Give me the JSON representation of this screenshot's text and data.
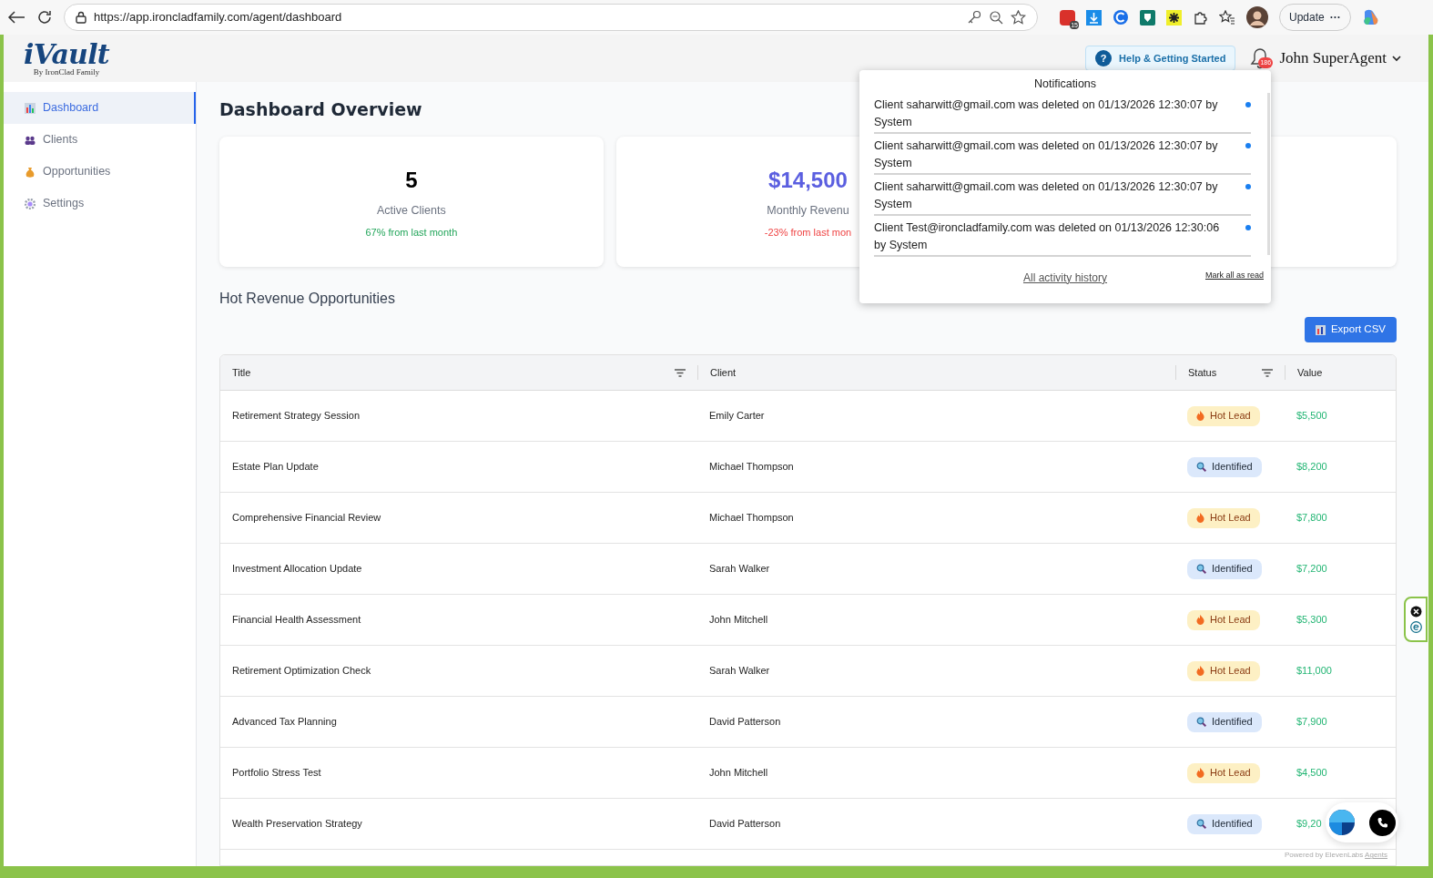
{
  "browser": {
    "url": "https://app.ironcladfamily.com/agent/dashboard",
    "calendar_badge": "15",
    "update_button": "Update",
    "update_more": "···"
  },
  "header": {
    "logo": "iVault",
    "logo_sub": "By IronClad Family",
    "help_button": "Help & Getting Started",
    "help_mark": "?",
    "bell_badge": "186",
    "user": "John SuperAgent"
  },
  "sidebar": {
    "items": [
      {
        "label": "Dashboard",
        "selected": true
      },
      {
        "label": "Clients",
        "selected": false
      },
      {
        "label": "Opportunities",
        "selected": false
      },
      {
        "label": "Settings",
        "selected": false
      }
    ]
  },
  "page_title": "Dashboard Overview",
  "stats": [
    {
      "value": "5",
      "label": "Active Clients",
      "change": "67% from last month"
    },
    {
      "value": "$14,500",
      "label": "Monthly Revenu",
      "change": "-23% from last mon"
    }
  ],
  "section_title": "Hot Revenue Opportunities",
  "export_button": "Export CSV",
  "table": {
    "columns": [
      {
        "label": "Title",
        "filter": true
      },
      {
        "label": "Client",
        "filter": false
      },
      {
        "label": "Status",
        "filter": true
      },
      {
        "label": "Value",
        "filter": false
      }
    ],
    "rows": [
      {
        "title": "Retirement Strategy Session",
        "client": "Emily Carter",
        "status": {
          "label": "Hot Lead",
          "kind": "hot"
        },
        "value": "$5,500"
      },
      {
        "title": "Estate Plan Update",
        "client": "Michael Thompson",
        "status": {
          "label": "Identified",
          "kind": "identified"
        },
        "value": "$8,200"
      },
      {
        "title": "Comprehensive Financial Review",
        "client": "Michael Thompson",
        "status": {
          "label": "Hot Lead",
          "kind": "hot"
        },
        "value": "$7,800"
      },
      {
        "title": "Investment Allocation Update",
        "client": "Sarah Walker",
        "status": {
          "label": "Identified",
          "kind": "identified"
        },
        "value": "$7,200"
      },
      {
        "title": "Financial Health Assessment",
        "client": "John Mitchell",
        "status": {
          "label": "Hot Lead",
          "kind": "hot"
        },
        "value": "$5,300"
      },
      {
        "title": "Retirement Optimization Check",
        "client": "Sarah Walker",
        "status": {
          "label": "Hot Lead",
          "kind": "hot"
        },
        "value": "$11,000"
      },
      {
        "title": "Advanced Tax Planning",
        "client": "David Patterson",
        "status": {
          "label": "Identified",
          "kind": "identified"
        },
        "value": "$7,900"
      },
      {
        "title": "Portfolio Stress Test",
        "client": "John Mitchell",
        "status": {
          "label": "Hot Lead",
          "kind": "hot"
        },
        "value": "$4,500"
      },
      {
        "title": "Wealth Preservation Strategy",
        "client": "David Patterson",
        "status": {
          "label": "Identified",
          "kind": "identified"
        },
        "value": "$9,20"
      }
    ]
  },
  "notifications": {
    "title": "Notifications",
    "items": [
      {
        "text": "Client saharwitt@gmail.com was deleted on 01/13/2026 12:30:07 by System",
        "unread": true
      },
      {
        "text": "Client saharwitt@gmail.com was deleted on 01/13/2026 12:30:07 by System",
        "unread": true
      },
      {
        "text": "Client saharwitt@gmail.com was deleted on 01/13/2026 12:30:07 by System",
        "unread": true
      },
      {
        "text": "Client Test@ironcladfamily.com was deleted on 01/13/2026 12:30:06 by System",
        "unread": true
      }
    ],
    "history_link": "All activity history",
    "mark_read_link": "Mark all as read"
  },
  "voice_widget": {
    "powered_by": "Powered by ElevenLabs",
    "agents_link": "Agents"
  }
}
